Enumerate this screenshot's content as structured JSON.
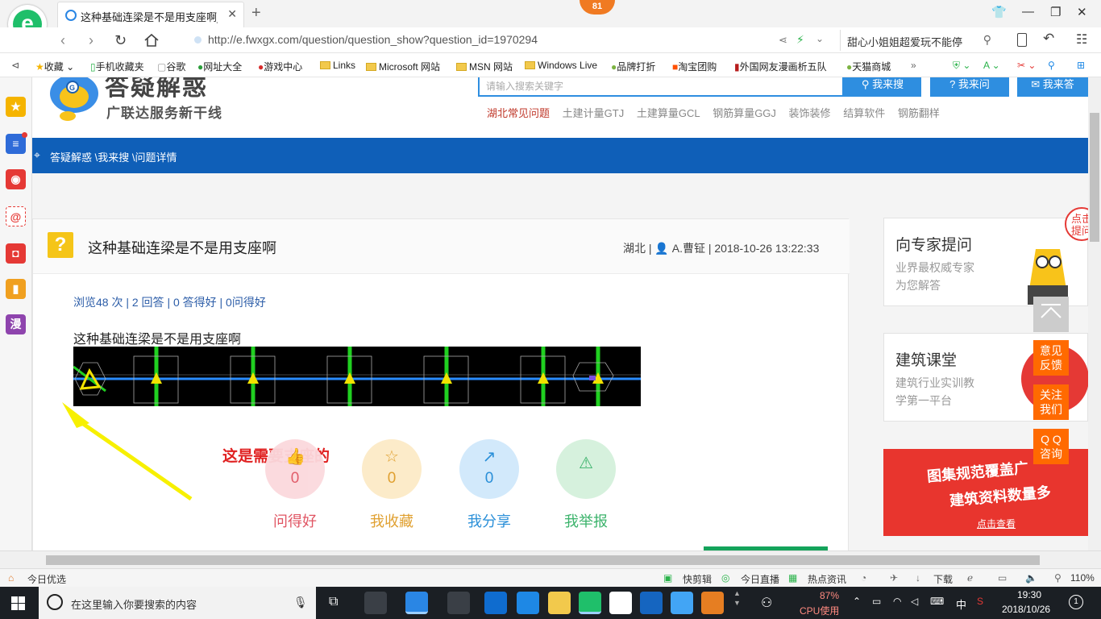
{
  "browser": {
    "tab_title": "这种基础连梁是不是用支座啊_",
    "tab_close": "✕",
    "new_tab": "+",
    "badge": "81",
    "url": "http://e.fwxgx.com/question/question_show?question_id=1970294",
    "search_query": "甜心小姐姐超爱玩不能停",
    "logo_letter": "e"
  },
  "bookmarks": [
    "收藏",
    "手机收藏夹",
    "谷歌",
    "网址大全",
    "游戏中心",
    "Links",
    "Microsoft 网站",
    "MSN 网站",
    "Windows Live",
    "品牌打折",
    "淘宝团购",
    "外国网友漫画析五队",
    "天猫商城"
  ],
  "leftbar": {
    "manga_label": "漫",
    "add": "+"
  },
  "site": {
    "name": "答疑解惑",
    "slogan": "广联达服务新干线",
    "search_placeholder": "请输入搜索关键字",
    "search_btn": "我来搜",
    "ask_btn": "我来问",
    "answer_btn": "我来答",
    "hot_links": [
      "湖北常见问题",
      "土建计量GTJ",
      "土建算量GCL",
      "钢筋算量GGJ",
      "装饰装修",
      "结算软件",
      "钢筋翻样"
    ],
    "breadcrumb": "答疑解惑 \\我来搜 \\问题详情"
  },
  "question": {
    "icon": "?",
    "title": "这种基础连梁是不是用支座啊",
    "meta": "湖北 | 👤 A.曹钲 | 2018-10-26 13:22:33",
    "stats": "浏览48 次 | 2 回答 | 0 答得好 | 0问得好",
    "body": "这种基础连梁是不是用支座啊",
    "annotation": "这是需要支座的"
  },
  "actions": [
    {
      "label": "问得好",
      "count": "0",
      "icon": "thumb"
    },
    {
      "label": "我收藏",
      "count": "0",
      "icon": "☆"
    },
    {
      "label": "我分享",
      "count": "0",
      "icon": "↗"
    },
    {
      "label": "我举报",
      "count": "",
      "icon": "⚠"
    }
  ],
  "sidebar": {
    "expert_title": "向专家提问",
    "expert_sub1": "业界最权威专家",
    "expert_sub2": "为您解答",
    "expert_bubble": "点击提问",
    "course_title": "建筑课堂",
    "course_sub1": "建筑行业实训教",
    "course_sub2": "学第一平台",
    "banner_line1": "图集规范覆盖广",
    "banner_line2": "建筑资料数量多",
    "banner_cta": "点击查看"
  },
  "float_buttons": [
    "意见\n反馈",
    "关注\n我们",
    "Q Q\n咨询"
  ],
  "statusbar": {
    "left": "今日优选",
    "items": [
      "快剪辑",
      "今日直播",
      "热点资讯",
      "下载"
    ],
    "zoom": "110%"
  },
  "taskbar": {
    "search_placeholder": "在这里输入你要搜索的内容",
    "cpu_percent": "87%",
    "cpu_label": "CPU使用",
    "ime": "中",
    "time": "19:30",
    "date": "2018/10/26",
    "notif": "1"
  },
  "colors": {
    "brand_blue": "#0f5fb8",
    "search_blue": "#2e8ee0",
    "orange": "#ff6a00",
    "good": "#e05563",
    "fav": "#e0a030",
    "share": "#2a8fd8",
    "report": "#3bb36b"
  }
}
